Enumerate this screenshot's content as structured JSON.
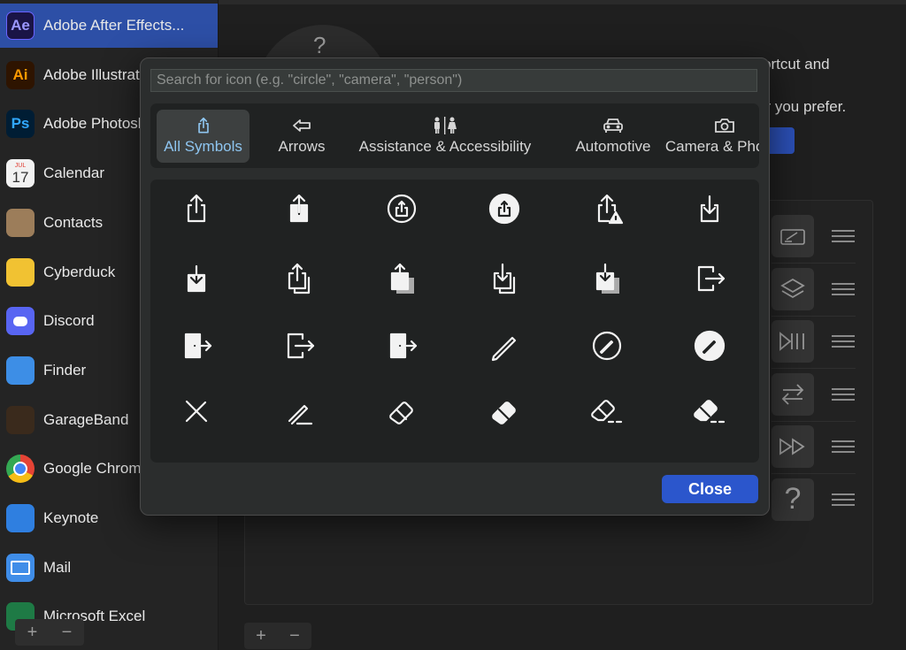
{
  "sidebar": {
    "apps": [
      {
        "name": "Adobe After Effects...",
        "icon": "after-effects-icon",
        "glyph": "Ae",
        "bg": "#1a1446",
        "fg": "#9b97ff",
        "selected": true
      },
      {
        "name": "Adobe Illustrator",
        "icon": "illustrator-icon",
        "glyph": "Ai",
        "bg": "#2e1400",
        "fg": "#ff9a00",
        "selected": false
      },
      {
        "name": "Adobe Photoshop",
        "icon": "photoshop-icon",
        "glyph": "Ps",
        "bg": "#001d34",
        "fg": "#31a8ff",
        "selected": false
      },
      {
        "name": "Calendar",
        "icon": "calendar-icon",
        "glyph": "17",
        "bg": "#f2f2f2",
        "fg": "#333333",
        "selected": false
      },
      {
        "name": "Contacts",
        "icon": "contacts-icon",
        "glyph": "",
        "bg": "#9c7d5a",
        "fg": "#ffffff",
        "selected": false
      },
      {
        "name": "Cyberduck",
        "icon": "cyberduck-icon",
        "glyph": "",
        "bg": "#f1c232",
        "fg": "#ffffff",
        "selected": false
      },
      {
        "name": "Discord",
        "icon": "discord-icon",
        "glyph": "",
        "bg": "#5865f2",
        "fg": "#ffffff",
        "selected": false
      },
      {
        "name": "Finder",
        "icon": "finder-icon",
        "glyph": "",
        "bg": "#3d8ee6",
        "fg": "#ffffff",
        "selected": false
      },
      {
        "name": "GarageBand",
        "icon": "garageband-icon",
        "glyph": "",
        "bg": "#3a2a1c",
        "fg": "#ffffff",
        "selected": false
      },
      {
        "name": "Google Chrome",
        "icon": "chrome-icon",
        "glyph": "",
        "bg": "#e9e9e9",
        "fg": "#ffffff",
        "selected": false
      },
      {
        "name": "Keynote",
        "icon": "keynote-icon",
        "glyph": "",
        "bg": "#2f7fe0",
        "fg": "#ffffff",
        "selected": false
      },
      {
        "name": "Mail",
        "icon": "mail-icon",
        "glyph": "",
        "bg": "#3f8de8",
        "fg": "#ffffff",
        "selected": false
      },
      {
        "name": "Microsoft Excel",
        "icon": "excel-icon",
        "glyph": "",
        "bg": "#1e7a45",
        "fg": "#ffffff",
        "selected": false
      }
    ],
    "calendar_month": "JUL",
    "add_label": "+",
    "remove_label": "−"
  },
  "background": {
    "help_glyph": "?",
    "text_line1": "ortcut and",
    "text_line2": "er you prefer.",
    "row_icons": [
      "edit-window-icon",
      "layers-icon",
      "play-pause-icon",
      "swap-arrows-icon",
      "fast-forward-icon",
      "question-icon"
    ],
    "add_label": "+",
    "remove_label": "−"
  },
  "modal": {
    "search_placeholder": "Search for icon (e.g. \"circle\", \"camera\", \"person\")",
    "search_value": "",
    "categories": [
      {
        "label": "All Symbols",
        "icon": "share-icon",
        "active": true
      },
      {
        "label": "Arrows",
        "icon": "arrow-left-icon",
        "active": false
      },
      {
        "label": "Assistance & Accessibility",
        "icon": "restroom-icon",
        "active": false
      },
      {
        "label": "Automotive",
        "icon": "car-icon",
        "active": false
      },
      {
        "label": "Camera & Photos",
        "icon": "camera-icon",
        "active": false
      }
    ],
    "symbols": [
      "square-and-arrow-up",
      "square-and-arrow-up-fill",
      "square-and-arrow-up-circle",
      "square-and-arrow-up-circle-fill",
      "square-and-arrow-up-trianglebadge",
      "square-and-arrow-down",
      "square-and-arrow-down-fill",
      "square-and-arrow-up-on-square",
      "square-and-arrow-up-on-square-fill",
      "square-and-arrow-down-on-square",
      "square-and-arrow-down-on-square-fill",
      "rectangle-portrait-and-arrow-right",
      "rectangle-portrait-and-arrow-right-fill",
      "rectangle-portrait-and-arrow-forward",
      "rectangle-portrait-and-arrow-forward-fill",
      "pencil",
      "pencil-circle",
      "pencil-circle-fill",
      "pencil-slash",
      "pencil-line",
      "eraser",
      "eraser-fill",
      "eraser-line-dashed",
      "eraser-line-dashed-fill"
    ],
    "close_label": "Close"
  }
}
